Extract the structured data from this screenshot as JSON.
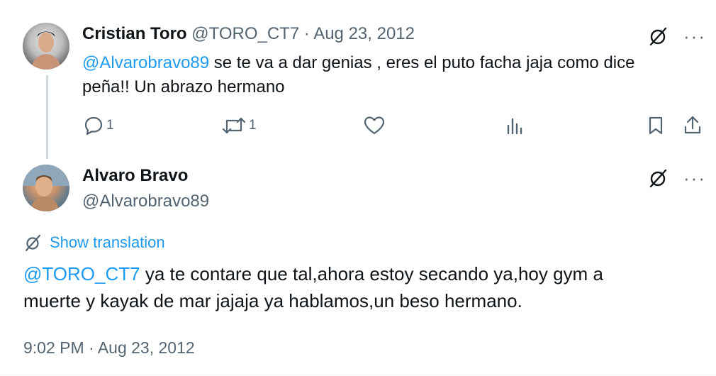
{
  "reply_tweet": {
    "author_name": "Cristian Toro",
    "handle": "@TORO_CT7",
    "separator": "·",
    "date": "Aug 23, 2012",
    "mention": "@Alvarobravo89",
    "text_line1": " se te va a dar genias , eres el puto facha jaja como dice",
    "text_line2": "peña!! Un abrazo hermano",
    "reply_count": "1",
    "retweet_count": "1",
    "more_label": "···"
  },
  "main_tweet": {
    "author_name": "Alvaro Bravo",
    "handle": "@Alvarobravo89",
    "translation_label": "Show translation",
    "mention": "@TORO_CT7",
    "text_line1": " ya te contare que tal,ahora estoy secando ya,hoy gym a",
    "text_line2": "muerte y kayak de mar jajaja ya hablamos,un beso hermano.",
    "timestamp": "9:02 PM · Aug 23, 2012",
    "more_label": "···"
  },
  "colors": {
    "accent": "#1d9bf0",
    "muted": "#536471",
    "text": "#0f1419",
    "thread_line": "#cfd9de"
  },
  "icons": [
    "reply-icon",
    "retweet-icon",
    "like-icon",
    "views-icon",
    "bookmark-icon",
    "share-icon",
    "grok-icon",
    "translate-icon",
    "more-icon"
  ]
}
